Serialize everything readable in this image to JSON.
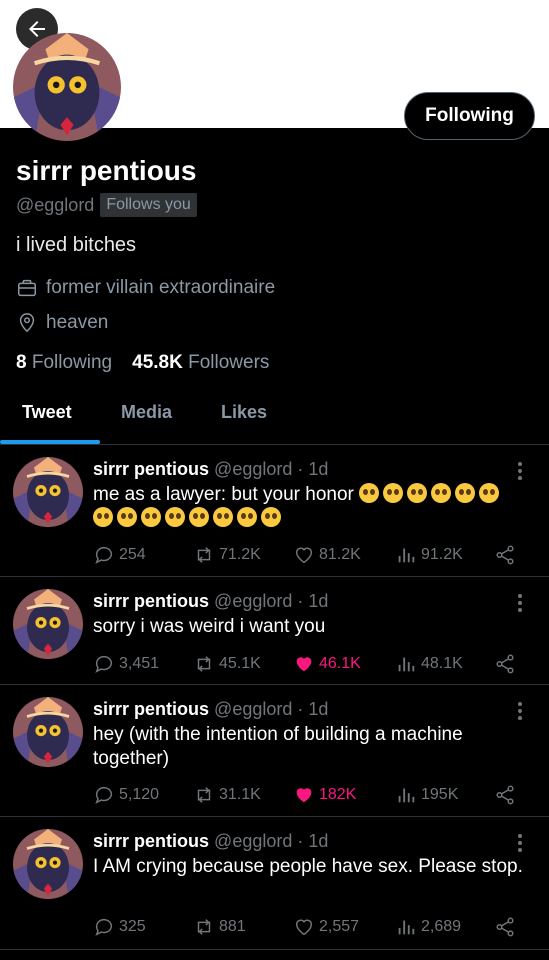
{
  "profile": {
    "following_button": "Following",
    "display_name": "sirrr pentious",
    "handle": "@egglord",
    "follows_you": "Follows you",
    "bio": "i lived bitches",
    "job": "former villain extraordinaire",
    "location": "heaven",
    "following_count": "8",
    "following_label": "Following",
    "followers_count": "45.8K",
    "followers_label": "Followers"
  },
  "tabs": [
    {
      "label": "Tweet",
      "active": true
    },
    {
      "label": "Media",
      "active": false
    },
    {
      "label": "Likes",
      "active": false
    }
  ],
  "tweets": [
    {
      "name": "sirrr pentious",
      "handle": "@egglord",
      "time": "· 1d",
      "text": "me as a lawyer: but your honor",
      "emoji_count": 14,
      "replies": "254",
      "retweets": "71.2K",
      "likes": "81.2K",
      "views": "91.2K",
      "liked": false
    },
    {
      "name": "sirrr pentious",
      "handle": "@egglord",
      "time": "· 1d",
      "text": "sorry i was weird i want you",
      "replies": "3,451",
      "retweets": "45.1K",
      "likes": "46.1K",
      "views": "48.1K",
      "liked": true
    },
    {
      "name": "sirrr pentious",
      "handle": "@egglord",
      "time": "· 1d",
      "text": "hey (with the intention of building a machine together)",
      "replies": "5,120",
      "retweets": "31.1K",
      "likes": "182K",
      "views": "195K",
      "liked": true
    },
    {
      "name": "sirrr pentious",
      "handle": "@egglord",
      "time": "· 1d",
      "text": "I AM crying because people have sex. Please stop.",
      "replies": "325",
      "retweets": "881",
      "likes": "2,557",
      "views": "2,689",
      "liked": false
    }
  ],
  "colors": {
    "accent": "#1d9bf0",
    "like": "#f91880",
    "muted": "#71767b"
  },
  "icons": [
    "back-arrow-icon",
    "briefcase-icon",
    "location-pin-icon",
    "reply-icon",
    "retweet-icon",
    "heart-icon",
    "views-icon",
    "share-icon",
    "more-icon",
    "pleading-face-emoji"
  ]
}
